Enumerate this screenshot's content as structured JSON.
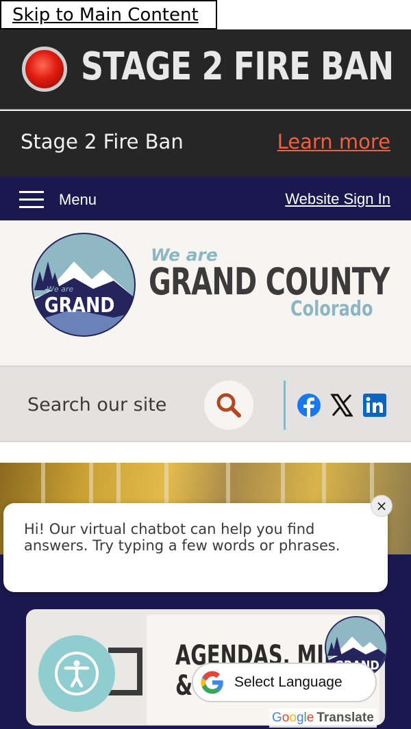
{
  "skip_link": {
    "label": "Skip to Main Content"
  },
  "fire_banner": {
    "title": "STAGE 2 FIRE BAN",
    "status_color": "#e01b10"
  },
  "alert": {
    "text": "Stage 2 Fire Ban",
    "link_label": "Learn more",
    "link_color": "#f0603e"
  },
  "nav": {
    "menu_label": "Menu",
    "sign_in_label": "Website Sign In",
    "bg_color": "#1b1850"
  },
  "logo": {
    "badge_text_small": "We are",
    "badge_text_big": "GRAND",
    "we_are": "We are",
    "name": "GRAND COUNTY",
    "state": "Colorado"
  },
  "search": {
    "placeholder": "Search our site",
    "social": [
      {
        "icon": "facebook-icon",
        "color": "#1877f2"
      },
      {
        "icon": "x-twitter-icon",
        "color": "#111111"
      },
      {
        "icon": "linkedin-icon",
        "color": "#0a66c2"
      }
    ]
  },
  "chatbot": {
    "message": "Hi! Our virtual chatbot can help you find answers. Try typing a few words or phrases.",
    "close_label": "×"
  },
  "card": {
    "title_line1": "AGENDAS, MIN",
    "title_line2": "&"
  },
  "translate": {
    "label": "Select Language",
    "powered_by_google": [
      "G",
      "o",
      "o",
      "g",
      "l",
      "e"
    ],
    "powered_suffix": "Translate"
  }
}
